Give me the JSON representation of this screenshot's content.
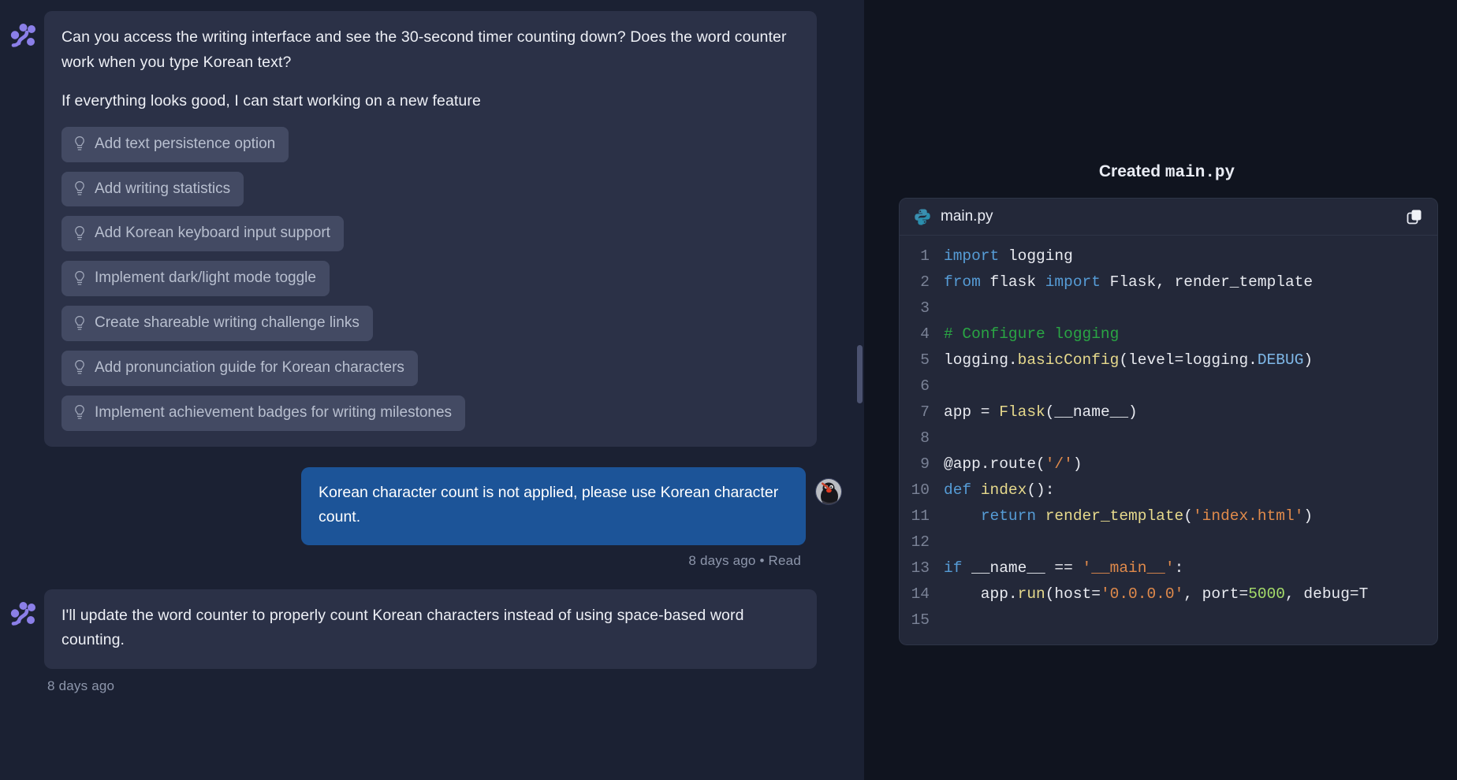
{
  "chat": {
    "assistant_avatar_name": "assistant-logo",
    "messages": [
      {
        "role": "assistant",
        "paragraphs": [
          "Can you access the writing interface and see the 30-second timer counting down? Does the word counter work when you type Korean text?",
          "If everything looks good, I can start working on a new feature"
        ],
        "suggestions": [
          "Add text persistence option",
          "Add writing statistics",
          "Add Korean keyboard input support",
          "Implement dark/light mode toggle",
          "Create shareable writing challenge links",
          "Add pronunciation guide for Korean characters",
          "Implement achievement badges for writing milestones"
        ]
      },
      {
        "role": "user",
        "text": "Korean character count is not applied, please use Korean character count.",
        "meta": "8 days ago • Read"
      },
      {
        "role": "assistant",
        "text": "I'll update the word counter to properly count Korean characters instead of using space-based word counting.",
        "meta": "8 days ago"
      }
    ],
    "suggestion_icon": "lightbulb-icon",
    "user_avatar_name": "user-avatar-penguin"
  },
  "code_panel": {
    "created_prefix": "Created",
    "created_filename": "main.py",
    "file_tab": {
      "language_icon": "python-icon",
      "filename": "main.py",
      "copy_icon": "copy-icon"
    },
    "line_numbers": [
      "1",
      "2",
      "3",
      "4",
      "5",
      "6",
      "7",
      "8",
      "9",
      "10",
      "11",
      "12",
      "13",
      "14",
      "15"
    ],
    "code_lines": [
      "import logging",
      "from flask import Flask, render_template",
      "",
      "# Configure logging",
      "logging.basicConfig(level=logging.DEBUG)",
      "",
      "app = Flask(__name__)",
      "",
      "@app.route('/')",
      "def index():",
      "    return render_template('index.html')",
      "",
      "if __name__ == '__main__':",
      "    app.run(host='0.0.0.0', port=5000, debug=T",
      ""
    ]
  },
  "colors": {
    "chat_panel_bg": "#1b2133",
    "assistant_bubble": "#2b3147",
    "user_bubble": "#1c5498",
    "suggestion_bg": "#434a63",
    "code_panel_bg": "#10141f",
    "code_card_bg": "#232839",
    "accent_purple": "#8b7fe8",
    "python_icon": "#2b9cc4",
    "keyword": "#569cd6",
    "string": "#e08a4b",
    "comment": "#2aa544",
    "function": "#e6d98c",
    "number": "#a6dd6a"
  }
}
